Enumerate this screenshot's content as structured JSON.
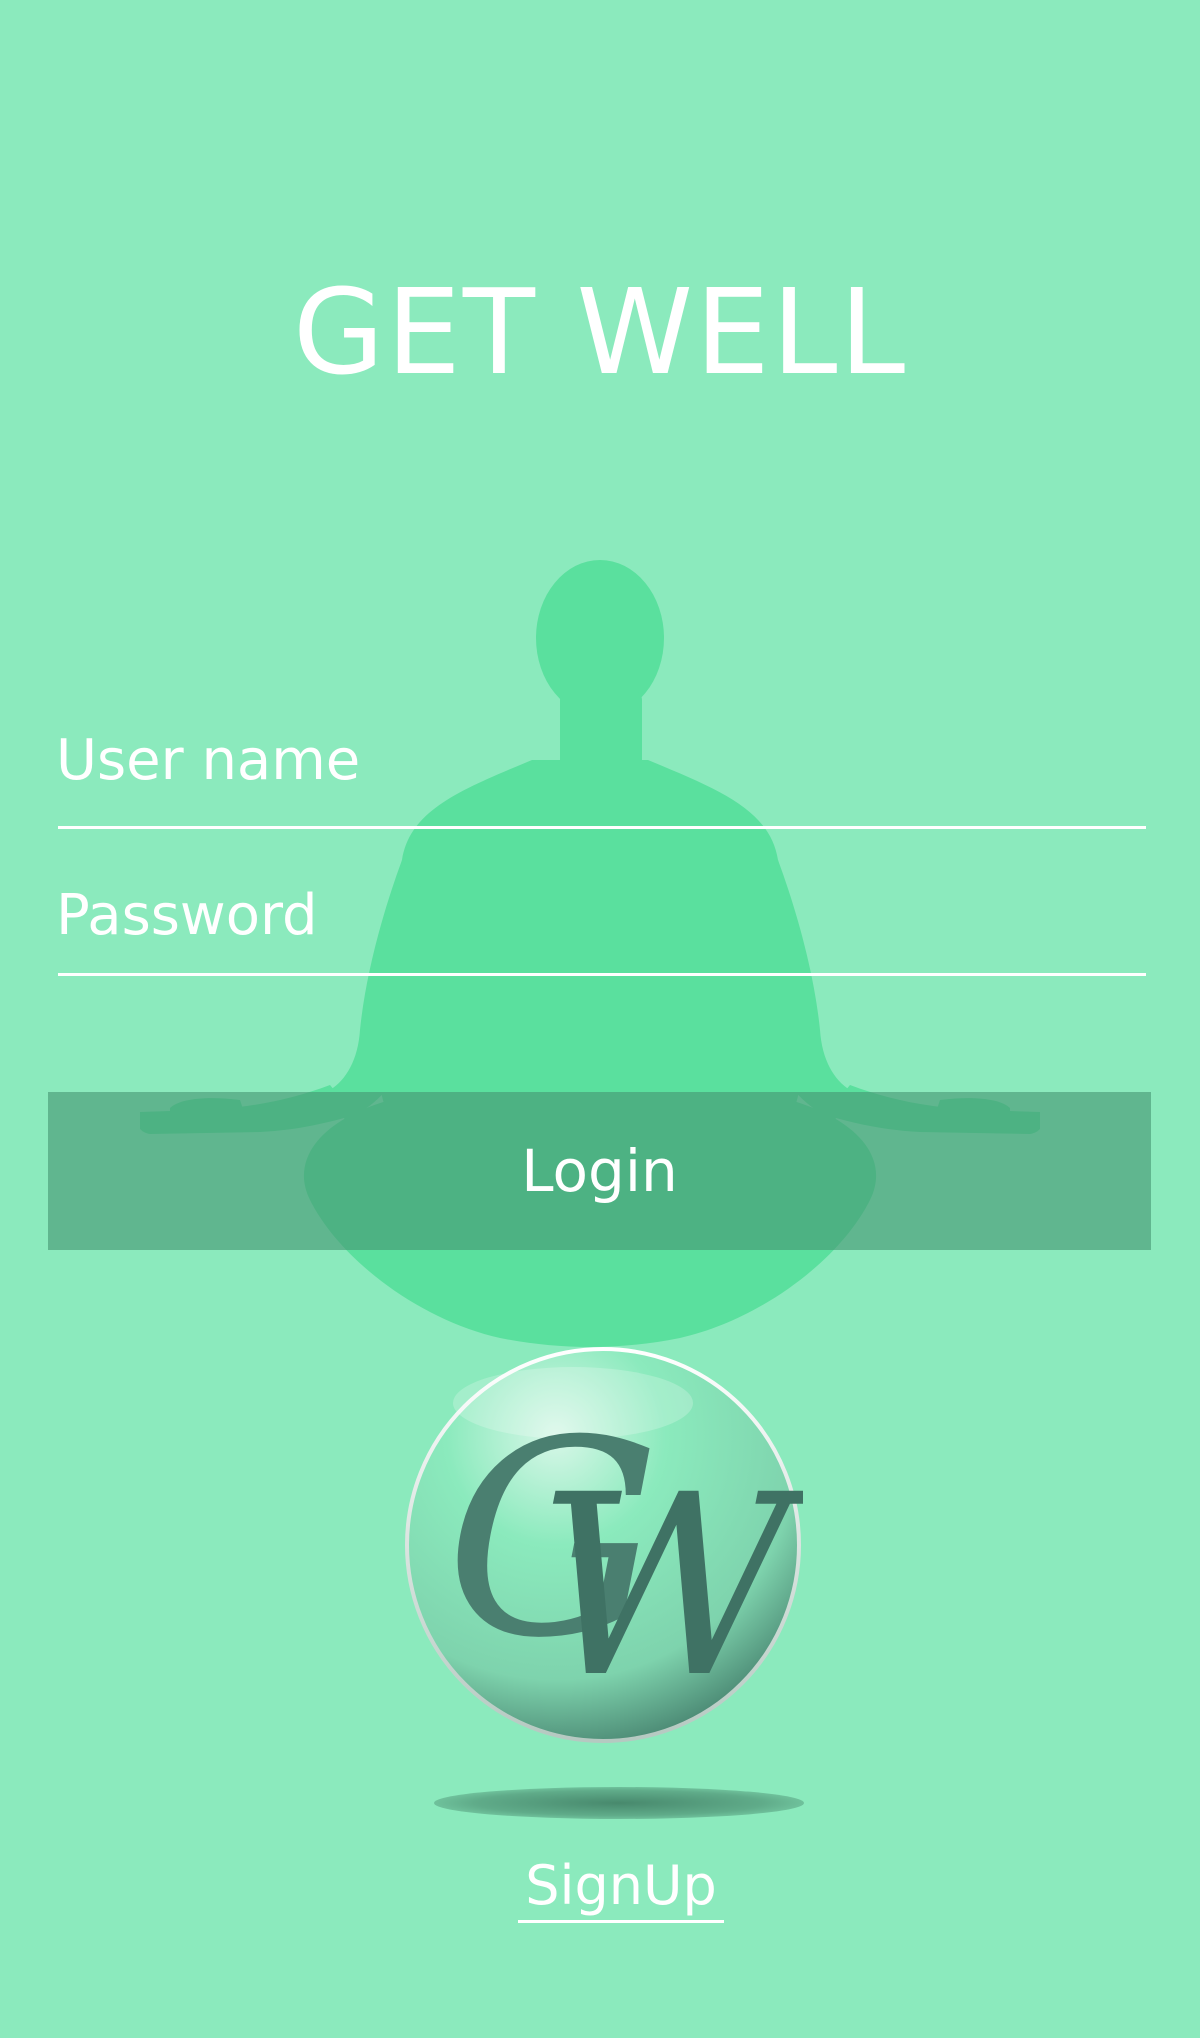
{
  "app": {
    "title": "GET WELL"
  },
  "login_form": {
    "username_placeholder": "User name",
    "password_placeholder": "Password",
    "login_label": "Login"
  },
  "logo": {
    "letters": "GW"
  },
  "signup": {
    "label": "SignUp"
  },
  "colors": {
    "background": "#8beabd",
    "silhouette": "#5ae09e",
    "button": "#46967380",
    "logo_letters": "#4a7f70",
    "text": "#ffffff"
  },
  "icons": {
    "background_figure": "meditation-silhouette-icon",
    "logo": "gw-logo-icon"
  }
}
